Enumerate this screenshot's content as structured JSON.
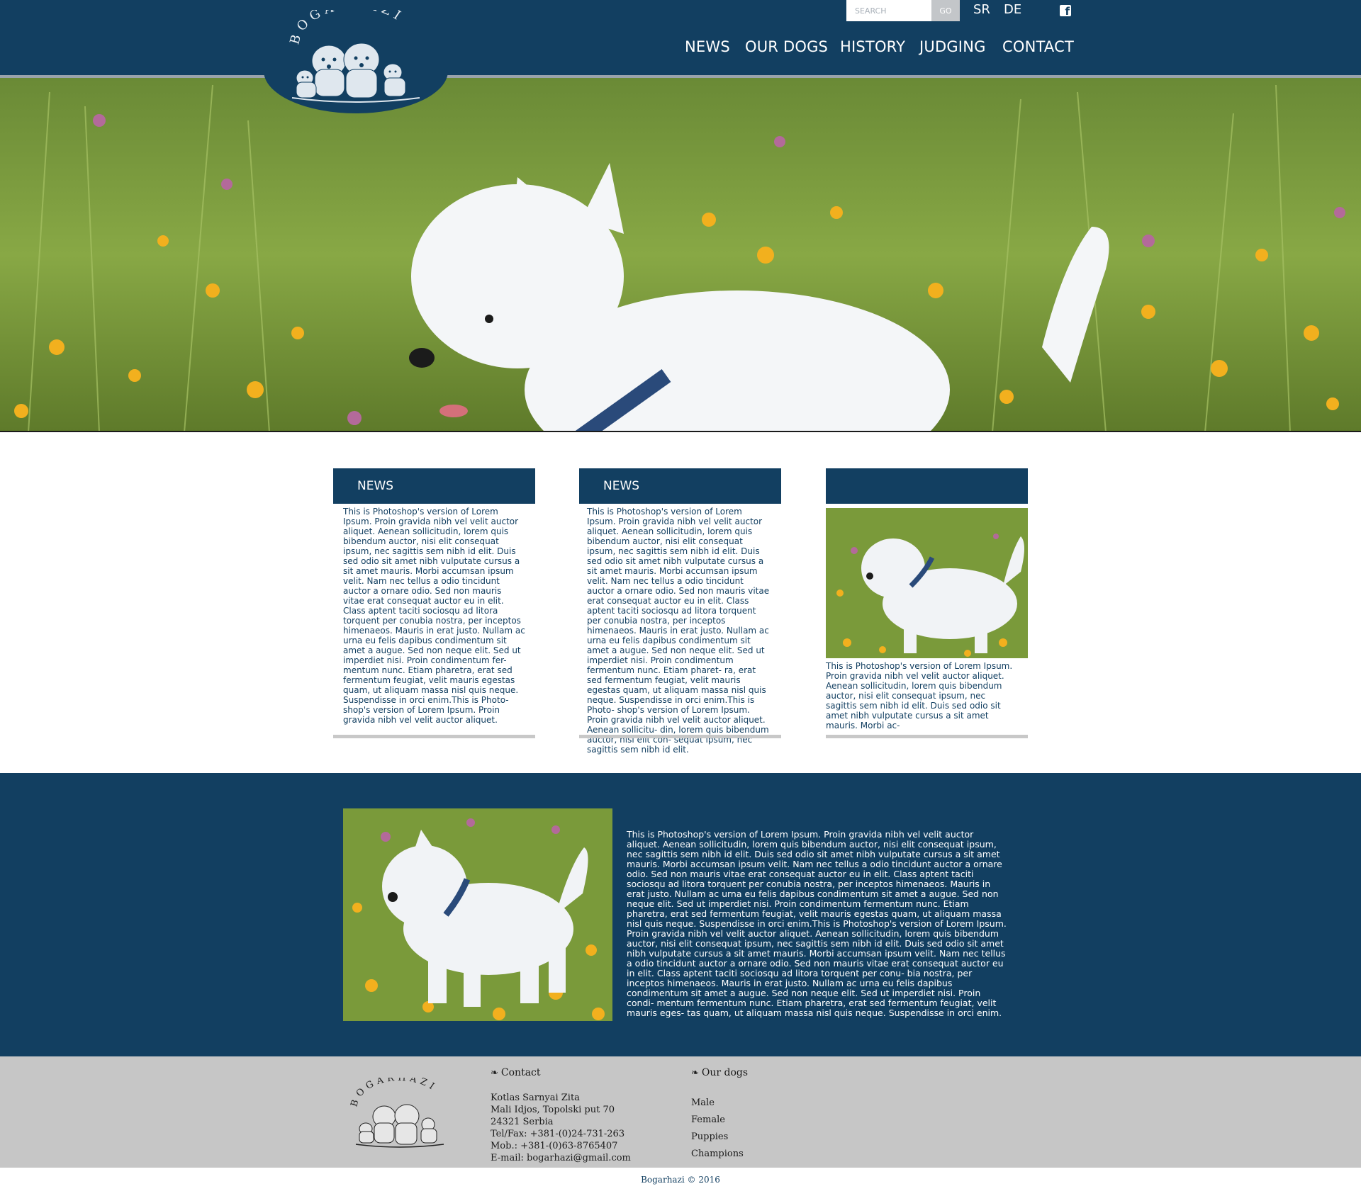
{
  "header": {
    "search": {
      "placeholder": "SEARCH",
      "button": "GO"
    },
    "languages": [
      "SR",
      "DE"
    ],
    "social_icon": "facebook-icon",
    "logo_text": "BOGARHAZI",
    "nav": [
      "NEWS",
      "OUR DOGS",
      "HISTORY",
      "JUDGING",
      "CONTACT"
    ]
  },
  "colors": {
    "primary": "#123f61",
    "footer": "#c6c6c6",
    "card_bar": "#c8c8c8"
  },
  "cards": [
    {
      "title": "NEWS",
      "text": "This is Photoshop's version  of Lorem Ipsum. Proin gravida nibh vel velit auctor aliquet. Aenean sollicitudin, lorem quis bibendum auctor, nisi elit consequat ipsum, nec sagittis sem nibh id elit. Duis sed odio sit amet nibh vulputate cursus a sit amet mauris. Morbi accumsan ipsum velit. Nam nec tellus a odio tincidunt auctor a ornare odio. Sed non  mauris vitae erat consequat auctor eu in elit. Class aptent taciti sociosqu ad litora torquent per conubia nostra, per inceptos himenaeos. Mauris in erat justo. Nullam ac urna eu felis dapibus condimentum sit amet a augue. Sed non neque elit. Sed ut imperdiet nisi. Proin condimentum fer- mentum nunc. Etiam pharetra, erat sed fermentum feugiat, velit mauris egestas quam, ut aliquam massa nisl quis neque. Suspendisse in orci enim.This is Photo- shop's version  of Lorem Ipsum. Proin gravida nibh vel velit auctor aliquet."
    },
    {
      "title": "NEWS",
      "text": "This is Photoshop's version  of Lorem Ipsum. Proin gravida nibh vel velit auctor aliquet. Aenean sollicitudin, lorem quis bibendum auctor, nisi elit consequat ipsum, nec sagittis sem nibh id elit. Duis sed odio sit amet nibh vulputate cursus a sit amet mauris. Morbi accumsan ipsum velit. Nam nec tellus a odio tincidunt auctor a ornare odio. Sed non mauris vitae erat consequat auctor eu in elit. Class aptent taciti sociosqu ad litora torquent per conubia nostra, per inceptos himenaeos. Mauris in erat justo. Nullam ac urna eu felis dapibus condimentum sit amet a augue. Sed non neque elit. Sed ut imperdiet nisi. Proin condimentum fermentum nunc. Etiam pharet- ra, erat sed fermentum feugiat, velit mauris egestas quam, ut aliquam massa nisl quis neque. Suspendisse in orci enim.This is Photo- shop's version  of Lorem Ipsum. Proin gravida nibh vel velit auctor aliquet. Aenean sollicitu- din, lorem quis bibendum auctor, nisi elit con- sequat ipsum, nec sagittis sem nibh id elit."
    },
    {
      "title": "",
      "text": "This is Photoshop's version  of Lorem Ipsum. Proin gravida nibh vel velit auctor aliquet. Aenean sollicitudin, lorem quis bibendum auctor, nisi elit consequat ipsum, nec sagittis sem nibh id elit. Duis sed odio sit amet nibh vulputate cursus a sit amet mauris. Morbi ac-"
    }
  ],
  "feature": {
    "text": "This is Photoshop's version  of Lorem Ipsum. Proin gravida nibh vel velit auctor aliquet. Aenean sollicitudin, lorem quis bibendum auctor, nisi elit consequat ipsum, nec sagittis sem nibh id elit. Duis sed odio sit amet nibh vulputate cursus a sit amet mauris. Morbi accumsan ipsum velit. Nam nec tellus a odio tincidunt auctor a ornare odio. Sed non mauris vitae erat consequat auctor eu in elit. Class aptent taciti sociosqu ad litora torquent per conubia nostra, per inceptos himenaeos. Mauris in erat justo. Nullam ac urna eu felis dapibus condimentum sit amet a augue. Sed non neque elit. Sed ut imperdiet nisi. Proin condimentum fermentum nunc. Etiam pharetra, erat sed fermentum feugiat, velit mauris egestas quam, ut aliquam massa nisl quis neque. Suspendisse in orci enim.This is Photoshop's version  of Lorem Ipsum. Proin gravida nibh vel velit auctor aliquet. Aenean sollicitudin, lorem quis bibendum auctor, nisi elit consequat ipsum, nec sagittis sem nibh id elit. Duis sed odio sit amet nibh vulputate cursus a sit amet mauris. Morbi accumsan ipsum velit. Nam nec tellus a odio tincidunt auctor a ornare odio. Sed non  mauris vitae erat consequat auctor eu in elit. Class aptent taciti sociosqu ad litora torquent per conu- bia nostra, per inceptos himenaeos. Mauris in erat justo. Nullam ac urna eu felis dapibus condimentum sit amet a augue. Sed non neque elit. Sed ut imperdiet nisi. Proin condi- mentum fermentum nunc. Etiam pharetra, erat sed fermentum feugiat, velit mauris eges- tas quam, ut aliquam massa nisl quis neque. Suspendisse in orci enim."
  },
  "footer": {
    "contact_title": "Contact",
    "contact_lines": [
      "Kotlas Sarnyai Zita",
      "Mali Idjos, Topolski put 70",
      "24321 Serbia",
      "Tel/Fax: +381-(0)24-731-263",
      "Mob.: +381-(0)63-8765407",
      "E-mail: bogarhazi@gmail.com"
    ],
    "dogs_title": "Our dogs",
    "dog_links": [
      "Male",
      "Female",
      "Puppies",
      "Champions"
    ],
    "copyright": "Bogarhazi © 2016"
  }
}
